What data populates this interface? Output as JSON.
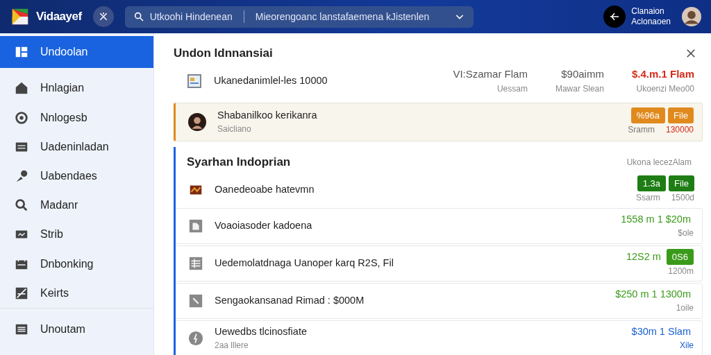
{
  "header": {
    "brand": "Vidaayef",
    "search": {
      "scope": "Utkoohi Hindenean",
      "value": "Mieorengoanc lanstafaemena kJistenlen"
    },
    "user": {
      "name": "Clanaion",
      "role": "Aclonaoen"
    }
  },
  "sidebar": {
    "items": [
      {
        "label": "Undoolan",
        "selected": true
      },
      {
        "label": "Hnlagian",
        "selected": false
      },
      {
        "label": "Nnlogesb",
        "selected": false
      },
      {
        "label": "Uadeninladan",
        "selected": false
      },
      {
        "label": "Uabendaes",
        "selected": false
      },
      {
        "label": "Madanr",
        "selected": false
      },
      {
        "label": "Strib",
        "selected": false
      },
      {
        "label": "Dnbonking",
        "selected": false
      },
      {
        "label": "Keirts",
        "selected": false
      }
    ],
    "footer_item": {
      "label": "Unoutam",
      "selected": false
    }
  },
  "panel": {
    "title": "Undon Idnnansiai",
    "summary": {
      "label": "Ukanedanimlel-les 10000",
      "stats": [
        {
          "value": "VI:Szamar Flam",
          "caption": "Uessam",
          "color": "#555555"
        },
        {
          "value": "$90aimm",
          "caption": "Mawar Slean",
          "color": "#555555"
        },
        {
          "value": "$.4.m.1 Flam",
          "caption": "Ukoenzi  Meo00",
          "color": "#d42a1a"
        }
      ]
    },
    "highlight": {
      "label": "Shabanilkoo kerikanra",
      "sub": "Saicliano",
      "color": "#e08a1e",
      "badges": [
        "%96a",
        "File"
      ],
      "captions": [
        {
          "text": "Sramm",
          "color": "#777777"
        },
        {
          "text": "130000",
          "color": "#d42a1a"
        }
      ]
    },
    "section": {
      "title": "Syarhan Indoprian",
      "note": "Ukona lecezAlam",
      "rows": [
        {
          "label": "Oanedeoabe hatevmn",
          "color": "#1e7d14",
          "figures": [
            {
              "kind": "badge",
              "text": "1.3a"
            },
            {
              "kind": "badge",
              "text": "File"
            }
          ],
          "captions": [
            "Ssarm",
            "1500d"
          ]
        },
        {
          "label": "Voaoiasoder kadoena",
          "color": "#3a9a1a",
          "figures": [
            {
              "kind": "text",
              "text": "1558 m 1 $20m"
            }
          ],
          "captions": [
            "$ole"
          ]
        },
        {
          "label": "Uedemolatdnaga Uanoper karq R2S, Fil",
          "color": "#3a9a1a",
          "figures": [
            {
              "kind": "text",
              "text": "12S2 m"
            },
            {
              "kind": "badge",
              "text": "0S6"
            }
          ],
          "captions": [
            "1200m"
          ]
        },
        {
          "label": "Sengaokansanad Rimad : $000M",
          "color": "#3a9a1a",
          "figures": [
            {
              "kind": "text",
              "text": "$250 m 1 1300m"
            }
          ],
          "captions": [
            "1oile"
          ]
        },
        {
          "label": "Uewedbs tlcinosfiate",
          "sub": "2aa lllere",
          "color": "#1a5fd0",
          "figures": [
            {
              "kind": "text",
              "text": "$30m 1 Slam"
            }
          ],
          "captions": [
            "Xile"
          ]
        }
      ]
    }
  }
}
